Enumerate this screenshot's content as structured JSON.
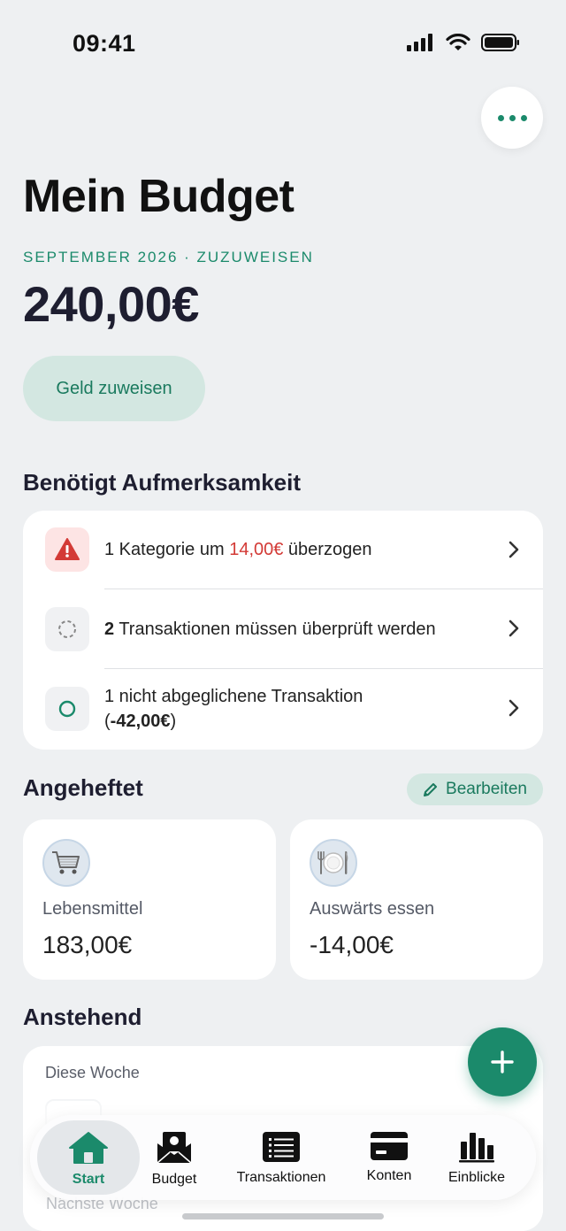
{
  "status": {
    "time": "09:41"
  },
  "header": {
    "title": "Mein Budget",
    "period": "SEPTEMBER 2026 · ZUZUWEISEN",
    "amount": "240,00€",
    "assign_label": "Geld zuweisen"
  },
  "attention": {
    "title": "Benötigt Aufmerksamkeit",
    "overspent": {
      "prefix": "1 Kategorie um ",
      "amount": "14,00€",
      "suffix": " überzogen"
    },
    "review": {
      "count": "2",
      "text": " Transaktionen müssen überprüft werden"
    },
    "unreconciled": {
      "line1": "1 nicht abgeglichene Transaktion",
      "line2_open": "(",
      "amount": "-42,00€",
      "line2_close": ")"
    }
  },
  "pinned": {
    "title": "Angeheftet",
    "edit_label": "Bearbeiten",
    "items": [
      {
        "label": "Lebensmittel",
        "value": "183,00€",
        "icon": "shopping-cart-icon"
      },
      {
        "label": "Auswärts essen",
        "value": "-14,00€",
        "icon": "plate-cutlery-icon"
      }
    ]
  },
  "upcoming": {
    "title": "Anstehend",
    "this_week": "Diese Woche",
    "next_week": "Nächste Woche"
  },
  "tabs": [
    {
      "label": "Start",
      "icon": "home-icon",
      "active": true
    },
    {
      "label": "Budget",
      "icon": "envelope-money-icon",
      "active": false
    },
    {
      "label": "Transaktionen",
      "icon": "list-icon",
      "active": false
    },
    {
      "label": "Konten",
      "icon": "card-icon",
      "active": false
    },
    {
      "label": "Einblicke",
      "icon": "bar-chart-icon",
      "active": false
    }
  ],
  "colors": {
    "accent": "#1b8a6b",
    "negative": "#d33a36",
    "background": "#eef0f2"
  }
}
